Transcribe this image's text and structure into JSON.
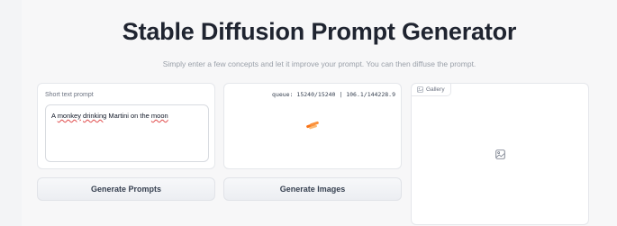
{
  "header": {
    "title": "Stable Diffusion Prompt Generator",
    "subtitle": "Simply enter a few concepts and let it improve your prompt. You can then diffuse the prompt."
  },
  "input_panel": {
    "label": "Short text prompt",
    "value_parts": [
      "A ",
      "monkey",
      " ",
      "drinking",
      " Martini on the ",
      "moon"
    ]
  },
  "output_panel": {
    "queue_text": "queue: 15240/15240 | 106.1/144228.9",
    "spinner_color": "#f97316"
  },
  "gallery": {
    "tag_label": "Gallery",
    "placeholder_icon": "image-icon"
  },
  "buttons": {
    "generate_prompts": "Generate Prompts",
    "generate_images": "Generate Images"
  }
}
